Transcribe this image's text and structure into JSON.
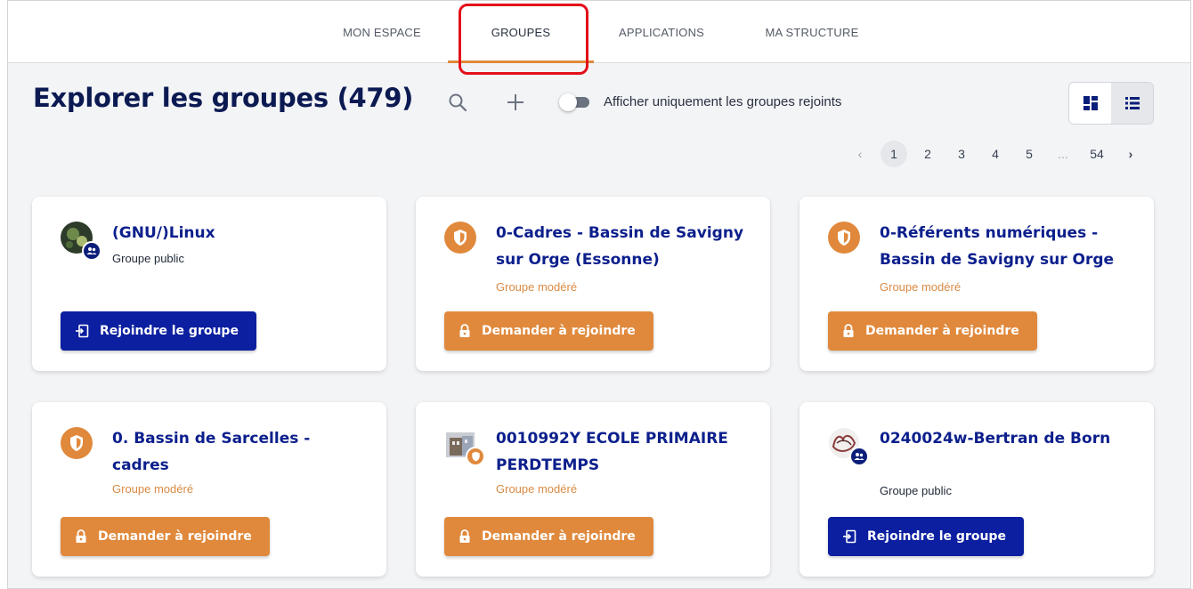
{
  "nav": {
    "tabs": [
      {
        "label": "MON ESPACE"
      },
      {
        "label": "GROUPES"
      },
      {
        "label": "APPLICATIONS"
      },
      {
        "label": "MA STRUCTURE"
      }
    ],
    "active_tab": "GROUPES"
  },
  "header": {
    "title": "Explorer les groupes (479)",
    "toggle_label": "Afficher uniquement les groupes rejoints",
    "toggle_on": false
  },
  "pagination": {
    "prev": "‹",
    "pages": [
      "1",
      "2",
      "3",
      "4",
      "5",
      "...",
      "54"
    ],
    "current": "1",
    "next": "›"
  },
  "groups": [
    {
      "name": "(GNU/)Linux",
      "type": "Groupe public",
      "action": "Rejoindre le groupe",
      "kind": "public",
      "avatar": "photo"
    },
    {
      "name": "0-Cadres - Bassin de Savigny sur Orge (Essonne)",
      "type": "Groupe modéré",
      "action": "Demander à rejoindre",
      "kind": "moderated",
      "avatar": "shield"
    },
    {
      "name": "0-Référents numériques - Bassin de Savigny sur Orge",
      "type": "Groupe modéré",
      "action": "Demander à rejoindre",
      "kind": "moderated",
      "avatar": "shield"
    },
    {
      "name": "0. Bassin de Sarcelles - cadres",
      "type": "Groupe modéré",
      "action": "Demander à rejoindre",
      "kind": "moderated",
      "avatar": "shield"
    },
    {
      "name": "0010992Y ECOLE PRIMAIRE PERDTEMPS",
      "type": "Groupe modéré",
      "action": "Demander à rejoindre",
      "kind": "moderated",
      "avatar": "photo"
    },
    {
      "name": "0240024w-Bertran de Born",
      "type": "Groupe public",
      "action": "Rejoindre le groupe",
      "kind": "public",
      "avatar": "photo"
    }
  ],
  "colors": {
    "accent_orange": "#e0893c",
    "primary_blue": "#0b1fa0",
    "title_navy": "#0c1a52",
    "highlight_red": "#e3101a"
  }
}
